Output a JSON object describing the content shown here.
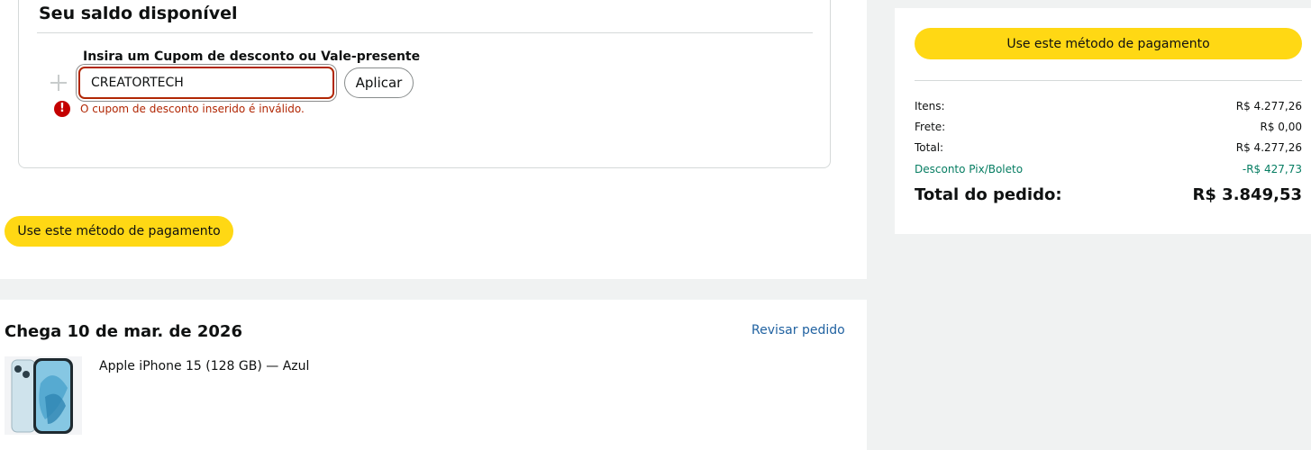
{
  "balance": {
    "title": "Seu saldo disponível",
    "coupon_label": "Insira um Cupom de desconto ou Vale-presente",
    "coupon_value": "CREATORTECH",
    "apply_label": "Aplicar",
    "error_message": "O cupom de desconto inserido é inválido."
  },
  "payment": {
    "use_method_label": "Use este método de pagamento"
  },
  "delivery": {
    "title": "Chega 10 de mar. de 2026",
    "review_link": "Revisar pedido",
    "product_name": "Apple iPhone 15 (128 GB) — Azul"
  },
  "summary": {
    "use_method_label": "Use este método de pagamento",
    "items_label": "Itens:",
    "items_value": "R$ 4.277,26",
    "shipping_label": "Frete:",
    "shipping_value": "R$ 0,00",
    "total_label": "Total:",
    "total_value": "R$ 4.277,26",
    "discount_label": "Desconto Pix/Boleto",
    "discount_value": "-R$ 427,73",
    "order_total_label": "Total do pedido:",
    "order_total_value": "R$ 3.849,53"
  },
  "colors": {
    "accent_button": "#ffd814",
    "error": "#b12704",
    "link": "#2162a1",
    "discount": "#067d62"
  }
}
